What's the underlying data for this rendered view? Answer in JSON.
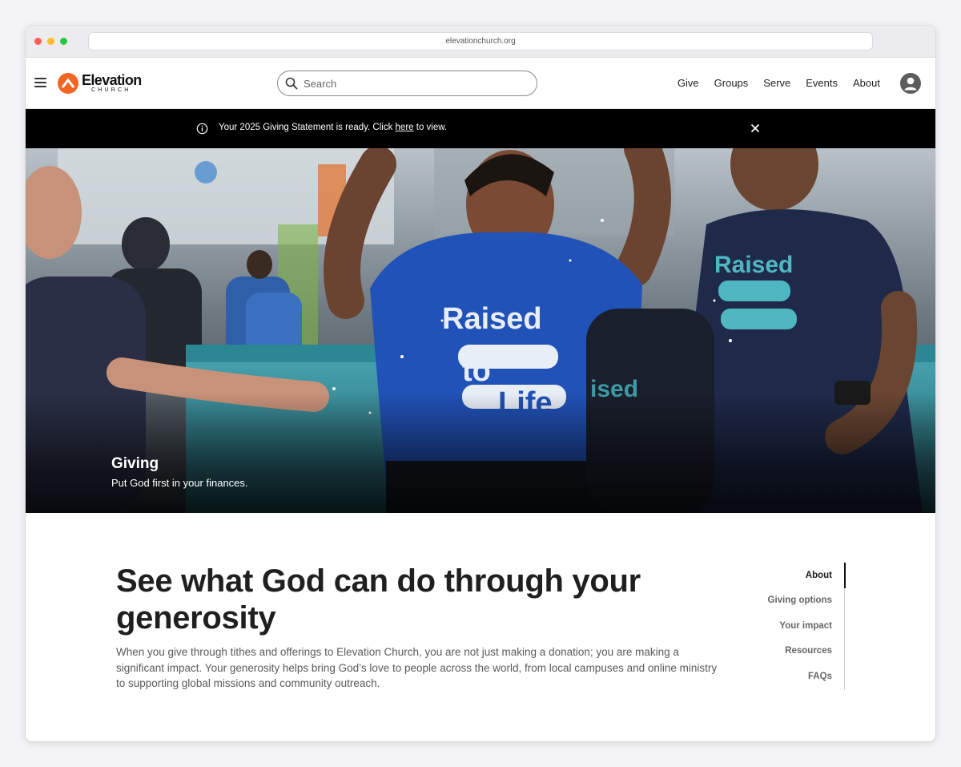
{
  "browser": {
    "url": "elevationchurch.org"
  },
  "header": {
    "logo_word": "Elevation",
    "logo_sub": "CHURCH",
    "search_placeholder": "Search",
    "nav": [
      "Give",
      "Groups",
      "Serve",
      "Events",
      "About"
    ]
  },
  "announcement": {
    "text_before": "Your 2025 Giving Statement is ready. Click ",
    "link_text": "here",
    "text_after": " to view."
  },
  "hero": {
    "title": "Giving",
    "subtitle": "Put God first in your finances.",
    "shirt_text": [
      "Raised",
      "to",
      "Life"
    ]
  },
  "main": {
    "heading": "See what God can do through your generosity",
    "body": "When you give through tithes and offerings to Elevation Church, you are not just making a donation; you are making a significant impact. Your generosity helps bring God’s love to people across the world, from local campuses and online ministry to supporting global missions and community outreach."
  },
  "side_nav": {
    "items": [
      "About",
      "Giving options",
      "Your impact",
      "Resources",
      "FAQs"
    ],
    "active": "About"
  },
  "colors": {
    "brand_orange": "#f26522",
    "announcement_bg": "#000000",
    "text_dark": "#1f1f1f",
    "text_muted": "#5a5a5a"
  }
}
